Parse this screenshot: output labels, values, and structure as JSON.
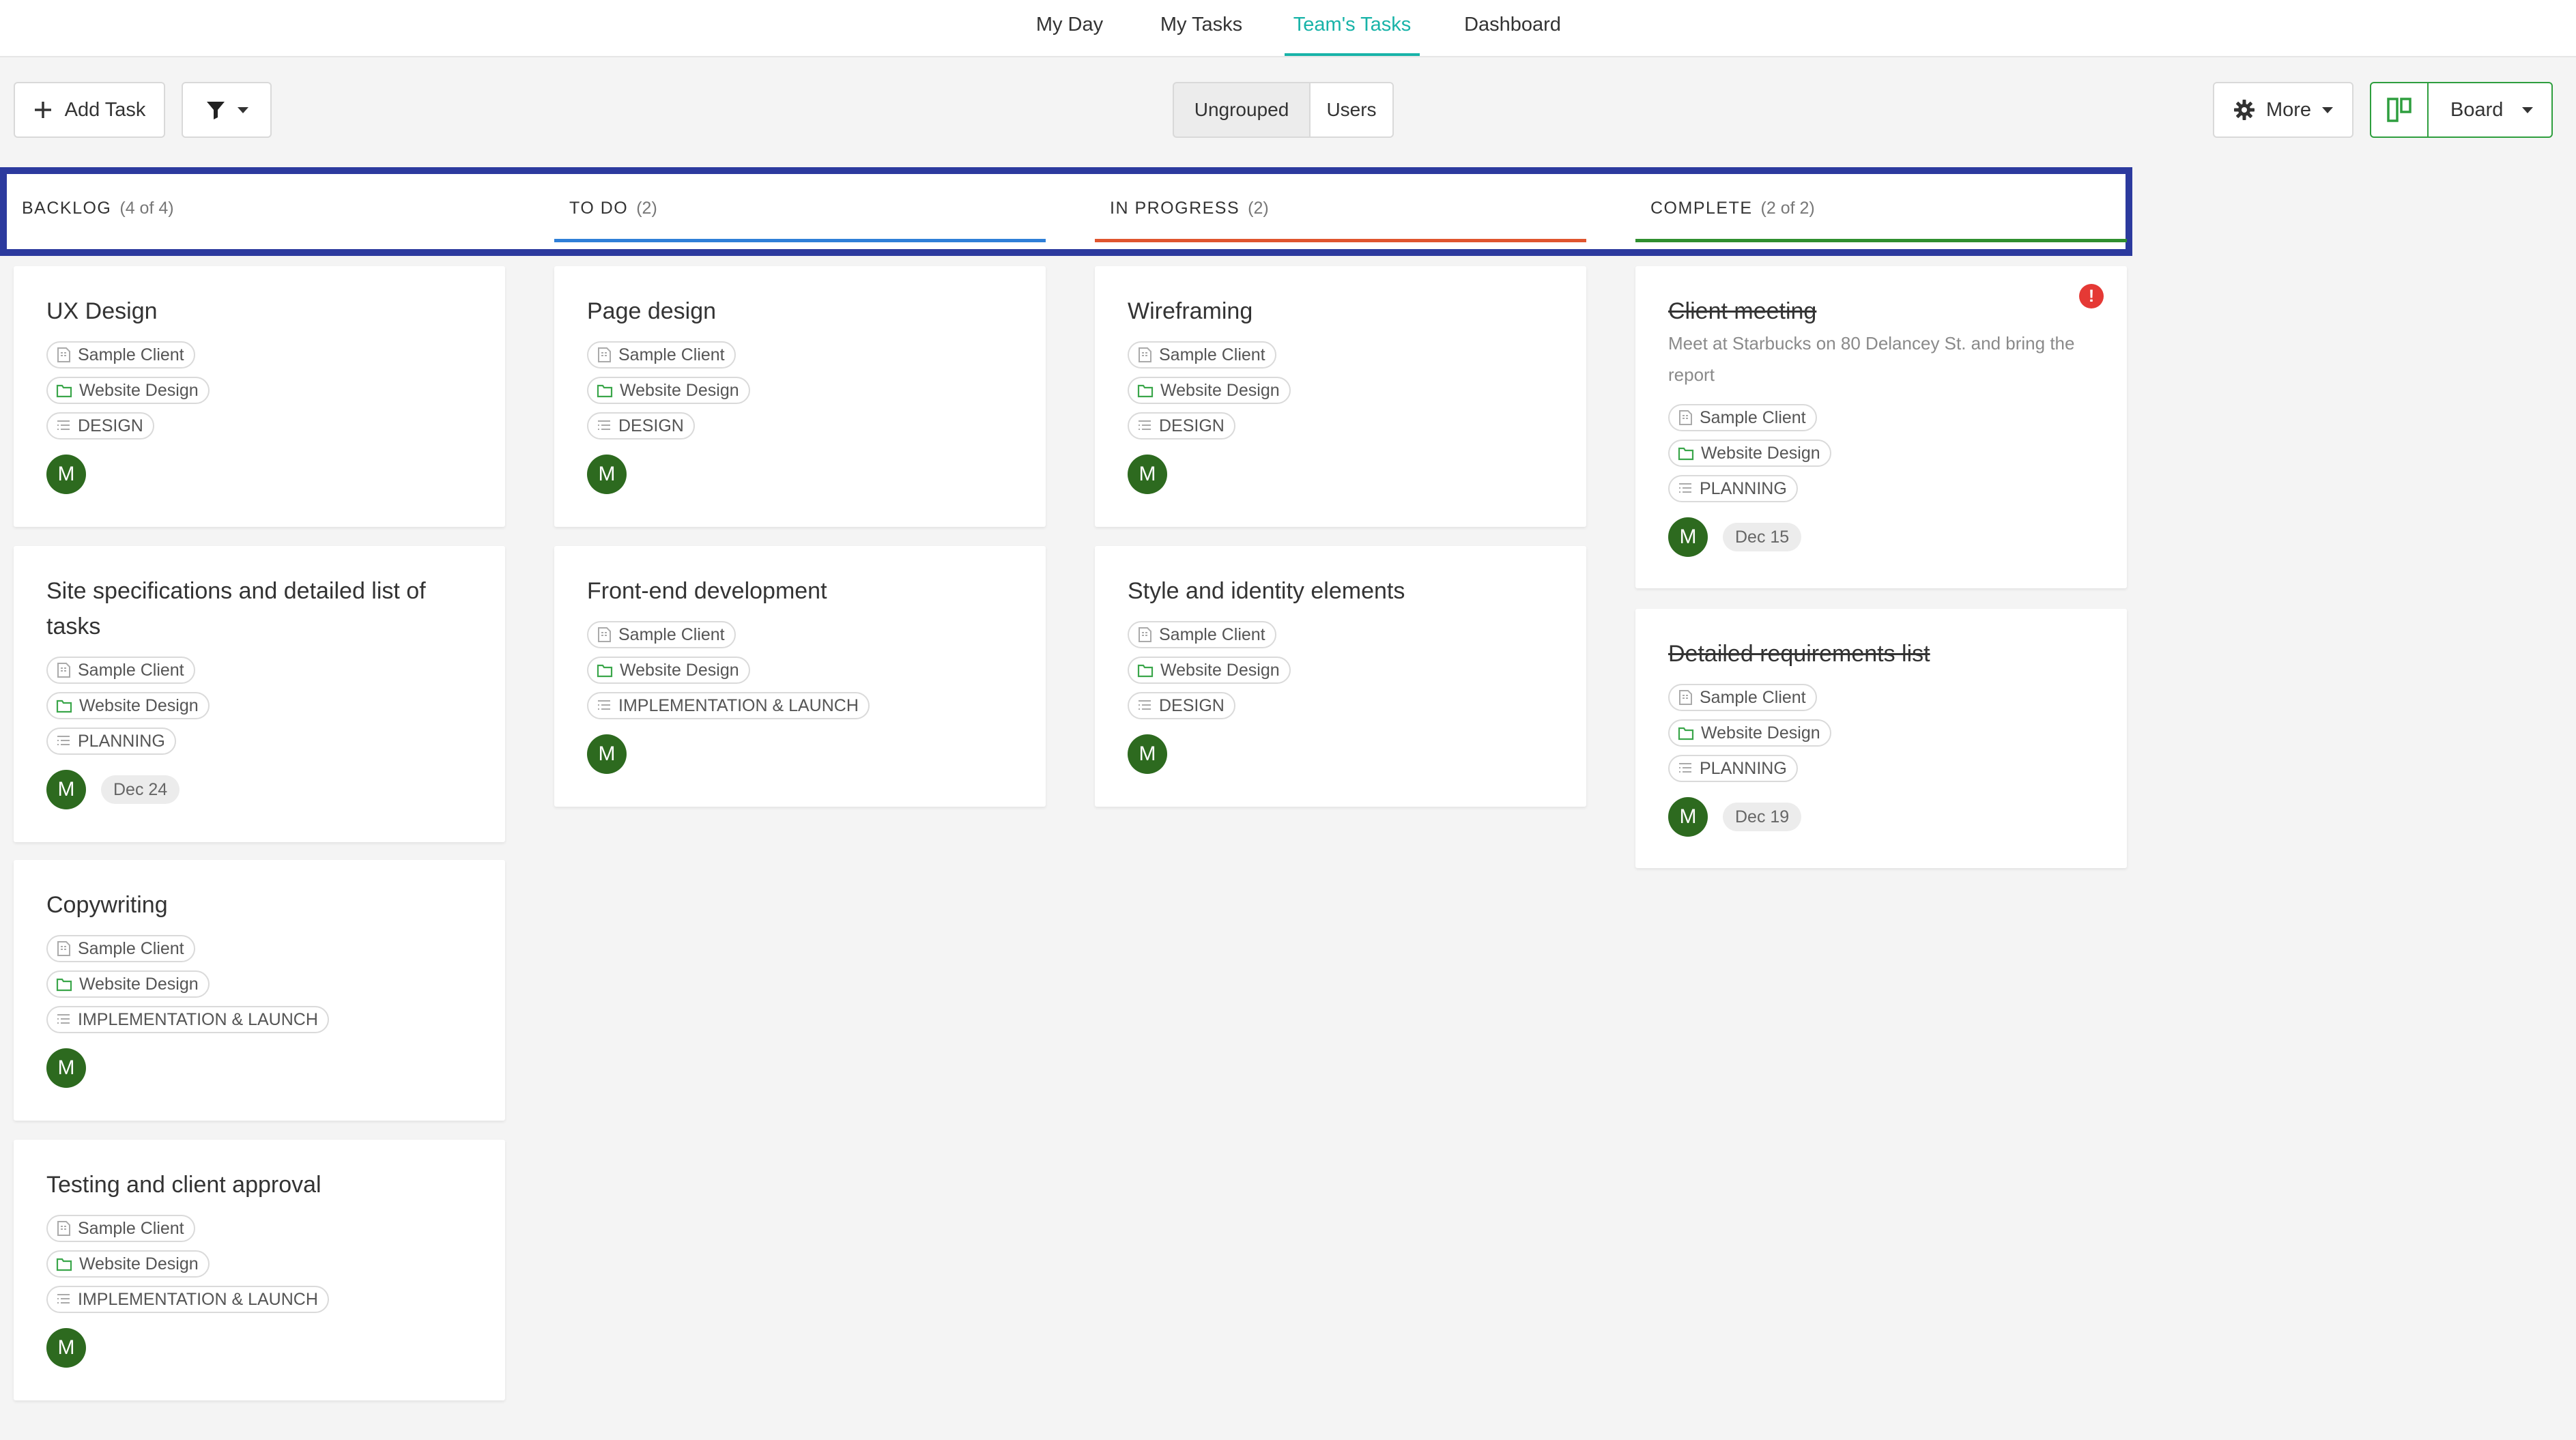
{
  "nav": {
    "tabs": [
      {
        "label": "My Day"
      },
      {
        "label": "My Tasks"
      },
      {
        "label": "Team's Tasks"
      },
      {
        "label": "Dashboard"
      }
    ],
    "active": "Team's Tasks"
  },
  "toolbar": {
    "add_task_label": "Add Task",
    "grouping": [
      "Ungrouped",
      "Users"
    ],
    "grouping_selected": "Ungrouped",
    "more_label": "More",
    "view_label": "Board"
  },
  "colors": {
    "accent": "#18b3a8",
    "header_highlight": "#2c3a9e",
    "todo_line": "#2f7fd8",
    "inprogress_line": "#e0552f",
    "complete_line": "#2f8f2f",
    "avatar": "#2d6a1f",
    "alert": "#e53935",
    "board_view_icon": "#2e9e3e"
  },
  "columns": [
    {
      "title": "BACKLOG",
      "count": "(4 of 4)"
    },
    {
      "title": "TO DO",
      "count": "(2)"
    },
    {
      "title": "IN PROGRESS",
      "count": "(2)"
    },
    {
      "title": "COMPLETE",
      "count": "(2 of 2)"
    }
  ],
  "cards": {
    "backlog": [
      {
        "title": "UX Design",
        "client": "Sample Client",
        "project": "Website Design",
        "stage": "DESIGN",
        "avatar": "M"
      },
      {
        "title": "Site specifications and detailed list of tasks",
        "client": "Sample Client",
        "project": "Website Design",
        "stage": "PLANNING",
        "avatar": "M",
        "date": "Dec 24"
      },
      {
        "title": "Copywriting",
        "client": "Sample Client",
        "project": "Website Design",
        "stage": "IMPLEMENTATION & LAUNCH",
        "avatar": "M"
      },
      {
        "title": "Testing and client approval",
        "client": "Sample Client",
        "project": "Website Design",
        "stage": "IMPLEMENTATION & LAUNCH",
        "avatar": "M"
      }
    ],
    "todo": [
      {
        "title": "Page design",
        "client": "Sample Client",
        "project": "Website Design",
        "stage": "DESIGN",
        "avatar": "M"
      },
      {
        "title": "Front-end development",
        "client": "Sample Client",
        "project": "Website Design",
        "stage": "IMPLEMENTATION & LAUNCH",
        "avatar": "M"
      }
    ],
    "inprogress": [
      {
        "title": "Wireframing",
        "client": "Sample Client",
        "project": "Website Design",
        "stage": "DESIGN",
        "avatar": "M"
      },
      {
        "title": "Style and identity elements",
        "client": "Sample Client",
        "project": "Website Design",
        "stage": "DESIGN",
        "avatar": "M"
      }
    ],
    "complete": [
      {
        "title": "Client meeting",
        "description": "Meet at Starbucks on 80 Delancey St. and bring the report",
        "client": "Sample Client",
        "project": "Website Design",
        "stage": "PLANNING",
        "avatar": "M",
        "date": "Dec 15",
        "alert": "!"
      },
      {
        "title": "Detailed requirements list",
        "client": "Sample Client",
        "project": "Website Design",
        "stage": "PLANNING",
        "avatar": "M",
        "date": "Dec 19"
      }
    ]
  },
  "icons": {
    "add": "plus-icon",
    "filter": "filter-icon",
    "more": "gear-icon",
    "board": "board-view-icon",
    "client_tag": "client-icon",
    "project_tag": "folder-icon",
    "stage_tag": "list-icon"
  }
}
